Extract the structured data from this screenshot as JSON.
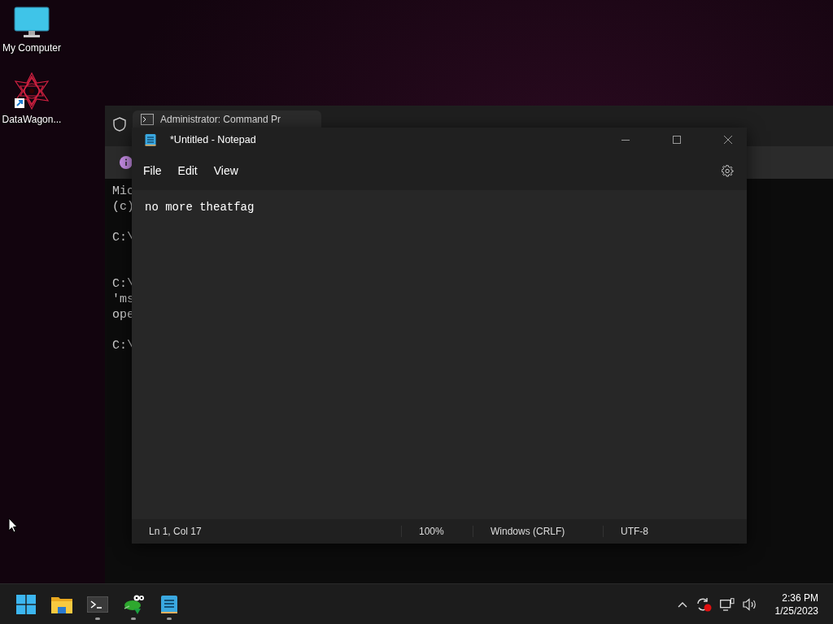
{
  "desktop_icons": [
    {
      "label": "My Computer",
      "kind": "computer"
    },
    {
      "label": "DataWagon...",
      "kind": "app"
    }
  ],
  "terminal": {
    "tab_title": "Administrator: Command Pr",
    "blocks": [
      [
        "Mic",
        "(c)"
      ],
      [
        "C:\\"
      ],
      [
        "C:\\",
        "'ms",
        "ope"
      ],
      [
        "C:\\"
      ]
    ]
  },
  "notepad": {
    "title": "*Untitled - Notepad",
    "menus": [
      "File",
      "Edit",
      "View"
    ],
    "content": "no more theatfag",
    "status": [
      "Ln 1, Col 17",
      "100%",
      "Windows (CRLF)",
      "UTF-8"
    ]
  },
  "taskbar": {
    "apps": [
      {
        "kind": "start",
        "running": false
      },
      {
        "kind": "folder",
        "running": false
      },
      {
        "kind": "terminal",
        "running": true
      },
      {
        "kind": "frog",
        "running": true
      },
      {
        "kind": "notepad",
        "running": true
      }
    ],
    "tray": [
      {
        "kind": "chevron"
      },
      {
        "kind": "sync"
      },
      {
        "kind": "network"
      },
      {
        "kind": "volume"
      }
    ],
    "time": "2:36 PM",
    "date": "1/25/2023"
  }
}
